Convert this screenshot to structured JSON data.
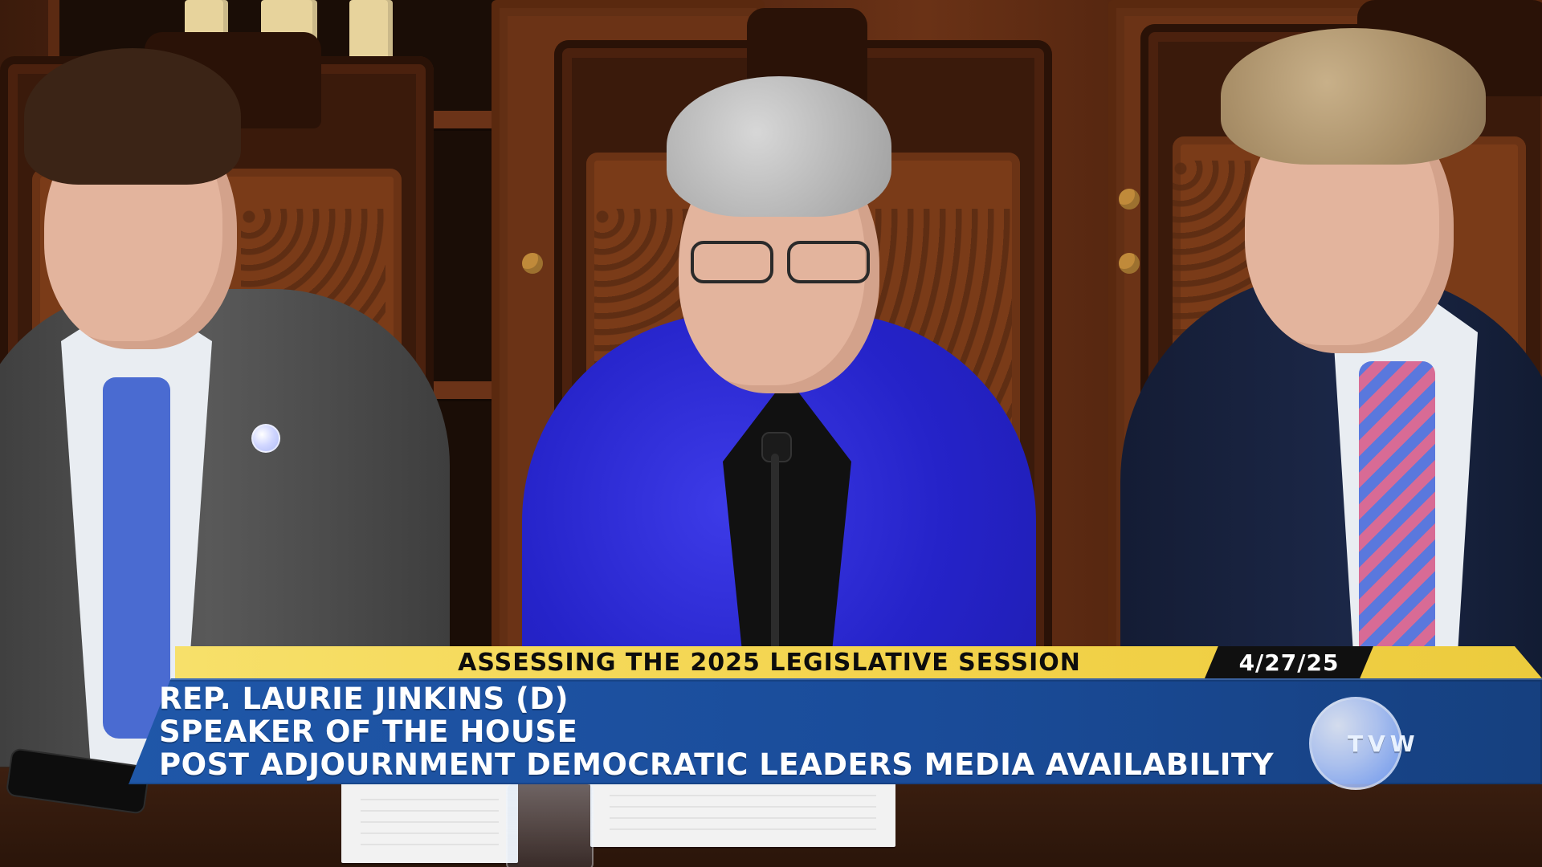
{
  "lower_third": {
    "headline": "ASSESSING THE 2025 LEGISLATIVE SESSION",
    "date": "4/27/25",
    "lines": [
      "REP. LAURIE JINKINS (D)",
      "SPEAKER OF THE HOUSE",
      "POST ADJOURNMENT DEMOCRATIC LEADERS MEDIA AVAILABILITY"
    ]
  },
  "broadcaster": {
    "name": "TVW"
  },
  "colors": {
    "title_bar": "#f3d34b",
    "info_bar": "#1f57a8",
    "date_tab": "#101010",
    "blazer": "#2523c9"
  }
}
